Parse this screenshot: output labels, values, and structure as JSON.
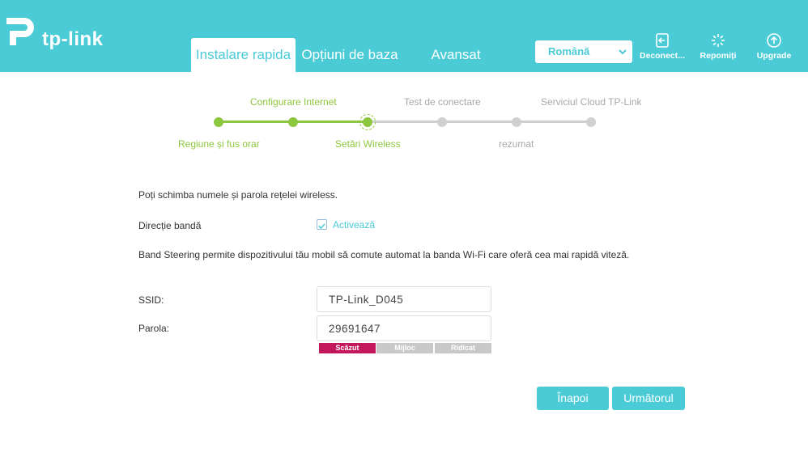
{
  "header": {
    "logo_text": "tp-link",
    "tabs": [
      {
        "label": "Instalare rapida",
        "active": true
      },
      {
        "label": "Opțiuni de baza",
        "active": false
      },
      {
        "label": "Avansat",
        "active": false
      }
    ],
    "language": "Română",
    "buttons": [
      {
        "label": "Deconect...",
        "icon": "logout-icon"
      },
      {
        "label": "Repomiți",
        "icon": "reboot-icon"
      },
      {
        "label": "Upgrade",
        "icon": "upgrade-icon"
      }
    ]
  },
  "stepper": {
    "steps": [
      {
        "label": "Regiune și fus orar",
        "state": "done"
      },
      {
        "label": "Configurare Internet",
        "state": "done"
      },
      {
        "label": "Setări Wireless",
        "state": "current"
      },
      {
        "label": "Test de conectare",
        "state": "todo"
      },
      {
        "label": "rezumat",
        "state": "todo"
      },
      {
        "label": "Serviciul Cloud TP-Link",
        "state": "todo"
      }
    ]
  },
  "form": {
    "intro": "Poți schimba numele și parola rețelei wireless.",
    "band_label": "Direcție bandă",
    "band_checkbox_label": "Activează",
    "band_checked": true,
    "band_desc": "Band Steering permite dispozitivului tău mobil să comute automat la banda Wi-Fi care oferă cea mai rapidă viteză.",
    "ssid_label": "SSID:",
    "ssid_value": "TP-Link_D045",
    "password_label": "Parola:",
    "password_value": "29691647",
    "strength": {
      "levels": [
        "Scăzut",
        "Mijloc",
        "Ridicat"
      ],
      "current": "Scăzut"
    }
  },
  "actions": {
    "back": "Înapoi",
    "next": "Următorul"
  },
  "colors": {
    "accent": "#4acbd6",
    "progress_done": "#8dc63f",
    "progress_todo": "#d0d0d0",
    "strength_low": "#c2185b",
    "strength_inactive": "#c8c8c8"
  }
}
